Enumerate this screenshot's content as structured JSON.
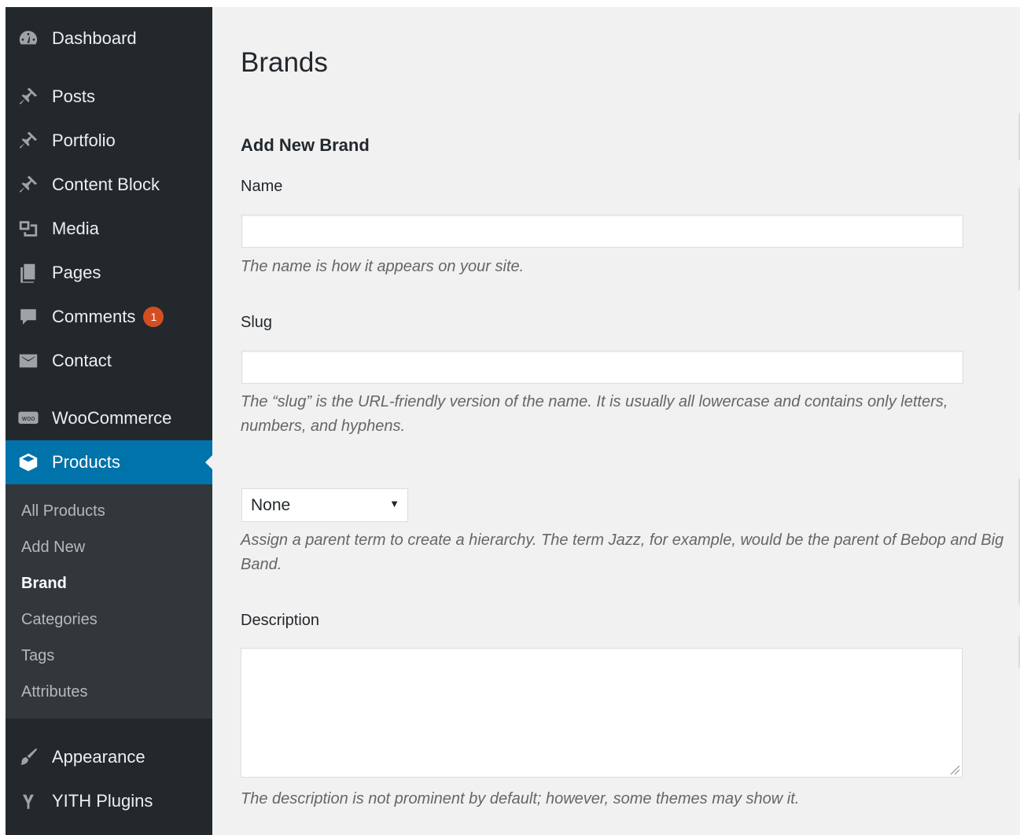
{
  "sidebar": {
    "items": [
      {
        "label": "Dashboard",
        "icon": "dashboard-icon"
      },
      {
        "label": "Posts",
        "icon": "pin-icon"
      },
      {
        "label": "Portfolio",
        "icon": "pin-icon"
      },
      {
        "label": "Content Block",
        "icon": "pin-icon"
      },
      {
        "label": "Media",
        "icon": "media-icon"
      },
      {
        "label": "Pages",
        "icon": "pages-icon"
      },
      {
        "label": "Comments",
        "icon": "comment-icon",
        "badge": "1"
      },
      {
        "label": "Contact",
        "icon": "envelope-icon"
      },
      {
        "label": "WooCommerce",
        "icon": "woo-icon"
      },
      {
        "label": "Products",
        "icon": "box-icon"
      },
      {
        "label": "Appearance",
        "icon": "brush-icon"
      },
      {
        "label": "YITH Plugins",
        "icon": "yith-icon"
      }
    ],
    "submenu": [
      "All Products",
      "Add New",
      "Brand",
      "Categories",
      "Tags",
      "Attributes"
    ],
    "current_item": "Products",
    "current_subitem": "Brand"
  },
  "main": {
    "page_title": "Brands",
    "form_title": "Add New Brand",
    "name_label": "Name",
    "name_value": "",
    "name_hint": "The name is how it appears on your site.",
    "slug_label": "Slug",
    "slug_value": "",
    "slug_hint": "The “slug” is the URL-friendly version of the name. It is usually all lowercase and contains only letters, numbers, and hyphens.",
    "parent_value": "None",
    "parent_hint": "Assign a parent term to create a hierarchy. The term Jazz, for example, would be the parent of Bebop and Big Band.",
    "description_label": "Description",
    "description_value": "",
    "description_hint": "The description is not prominent by default; however, some themes may show it."
  },
  "colors": {
    "sidebar_bg": "#23282d",
    "submenu_bg": "#32373c",
    "accent": "#0073aa",
    "badge": "#d54e21",
    "content_bg": "#f1f1f1"
  }
}
